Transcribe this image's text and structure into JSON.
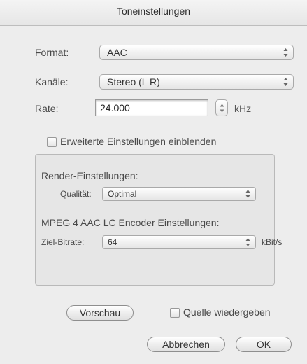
{
  "window": {
    "title": "Toneinstellungen"
  },
  "format": {
    "label": "Format:",
    "value": "AAC"
  },
  "channels": {
    "label": "Kanäle:",
    "value": "Stereo (L R)"
  },
  "rate": {
    "label": "Rate:",
    "value": "24.000",
    "unit": "kHz"
  },
  "advanced": {
    "label": "Erweiterte Einstellungen einblenden",
    "checked": false
  },
  "render": {
    "heading": "Render-Einstellungen:",
    "quality_label": "Qualität:",
    "quality_value": "Optimal"
  },
  "encoder": {
    "heading": "MPEG 4 AAC LC Encoder Einstellungen:",
    "bitrate_label": "Ziel-Bitrate:",
    "bitrate_value": "64",
    "bitrate_unit": "kBit/s"
  },
  "buttons": {
    "preview": "Vorschau",
    "play_source": "Quelle wiedergeben",
    "cancel": "Abbrechen",
    "ok": "OK"
  }
}
